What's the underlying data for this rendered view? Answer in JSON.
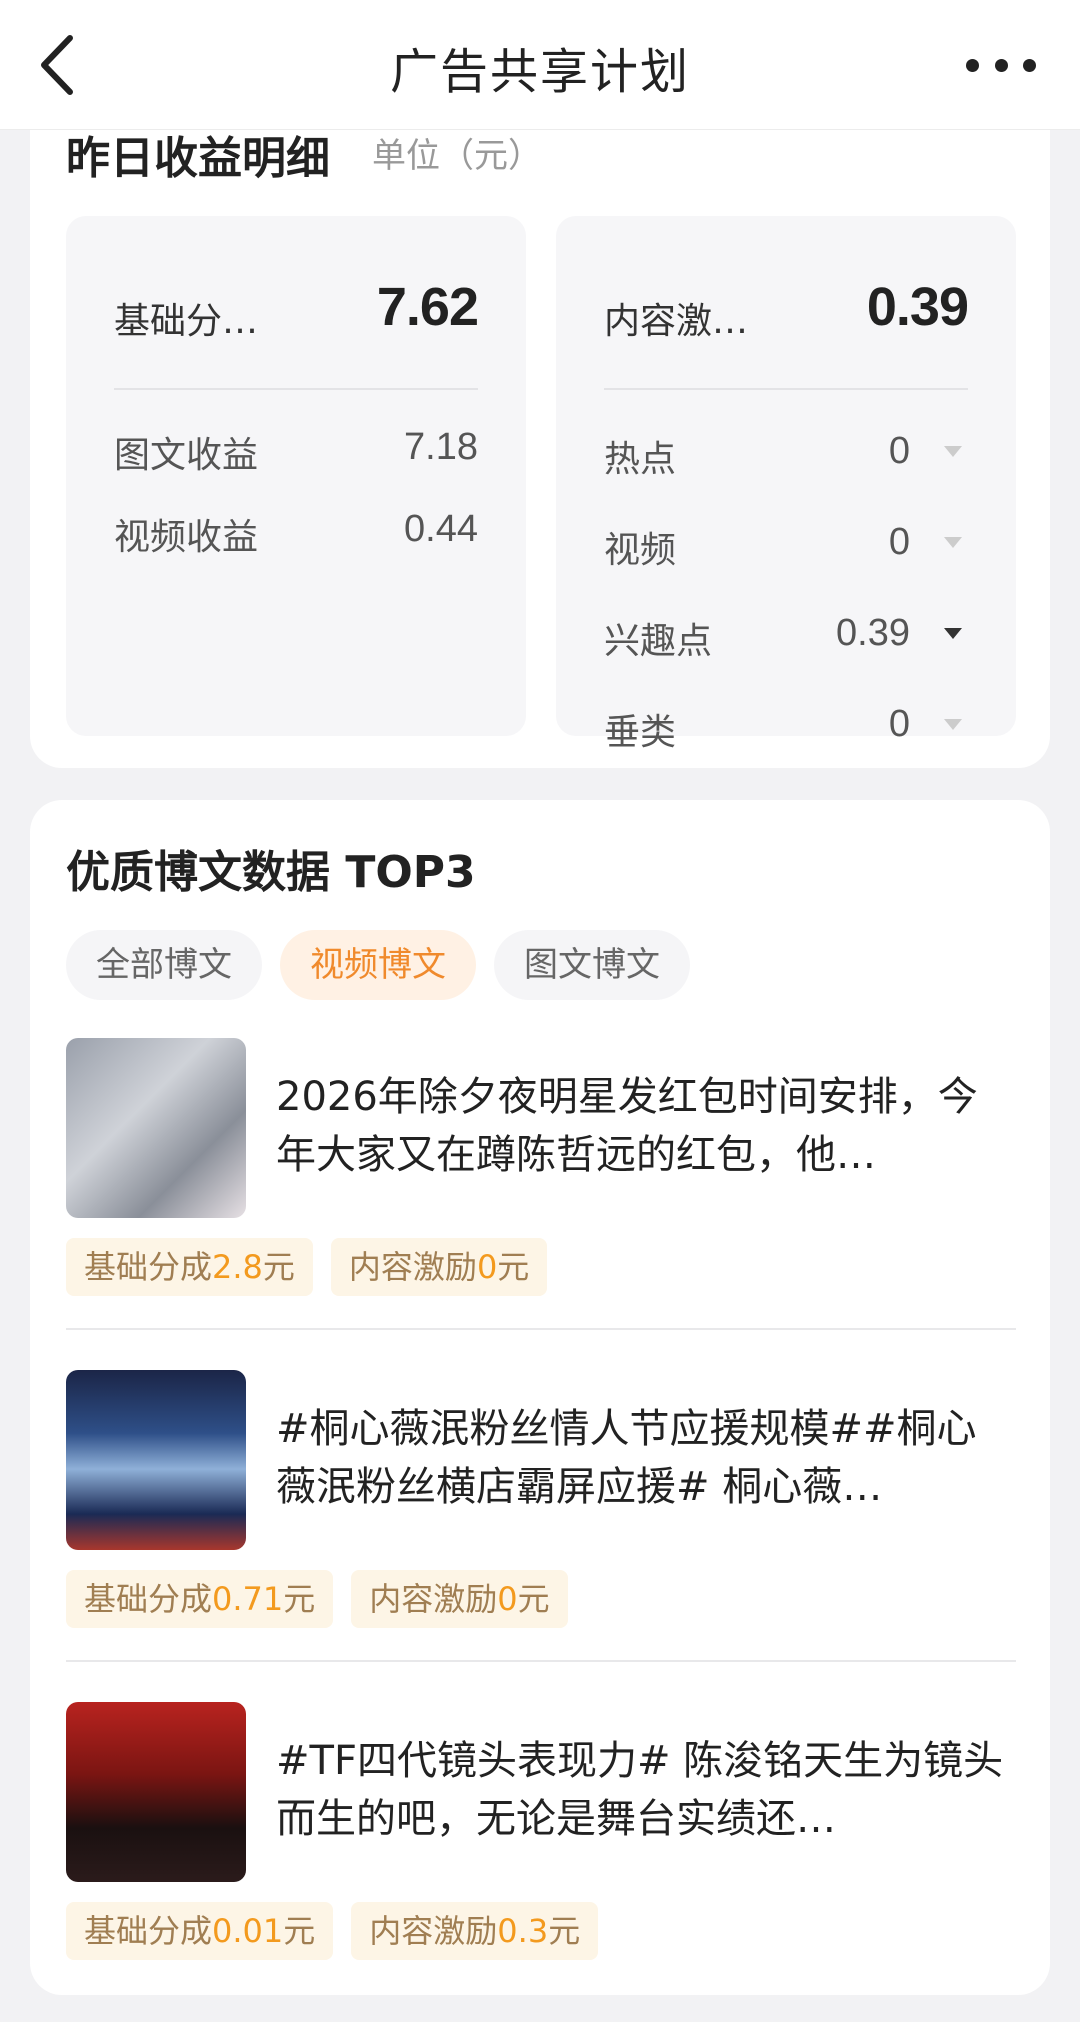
{
  "nav": {
    "title": "广告共享计划"
  },
  "earnings": {
    "title": "昨日收益明细",
    "unit": "单位（元）",
    "base": {
      "label": "基础分…",
      "value": "7.62",
      "rows": [
        {
          "label": "图文收益",
          "value": "7.18"
        },
        {
          "label": "视频收益",
          "value": "0.44"
        }
      ]
    },
    "incentive": {
      "label": "内容激…",
      "value": "0.39",
      "rows": [
        {
          "label": "热点",
          "value": "0"
        },
        {
          "label": "视频",
          "value": "0"
        },
        {
          "label": "兴趣点",
          "value": "0.39"
        },
        {
          "label": "垂类",
          "value": "0"
        }
      ]
    }
  },
  "top": {
    "title": "优质博文数据 TOP3",
    "tabs": [
      "全部博文",
      "视频博文",
      "图文博文"
    ],
    "active_tab": "视频博文",
    "items": [
      {
        "title": "2026年除夕夜明星发红包时间安排，今年大家又在蹲陈哲远的红包，他…",
        "base_label": "基础分成",
        "base_value": "2.8",
        "base_unit": "元",
        "inc_label": "内容激励",
        "inc_value": "0",
        "inc_unit": "元"
      },
      {
        "title": "#桐心薇泯粉丝情人节应援规模##桐心薇泯粉丝横店霸屏应援# 桐心薇…",
        "base_label": "基础分成",
        "base_value": "0.71",
        "base_unit": "元",
        "inc_label": "内容激励",
        "inc_value": "0",
        "inc_unit": "元"
      },
      {
        "title": "#TF四代镜头表现力# 陈浚铭天生为镜头而生的吧，无论是舞台实绩还…",
        "base_label": "基础分成",
        "base_value": "0.01",
        "base_unit": "元",
        "inc_label": "内容激励",
        "inc_value": "0.3",
        "inc_unit": "元"
      }
    ]
  }
}
